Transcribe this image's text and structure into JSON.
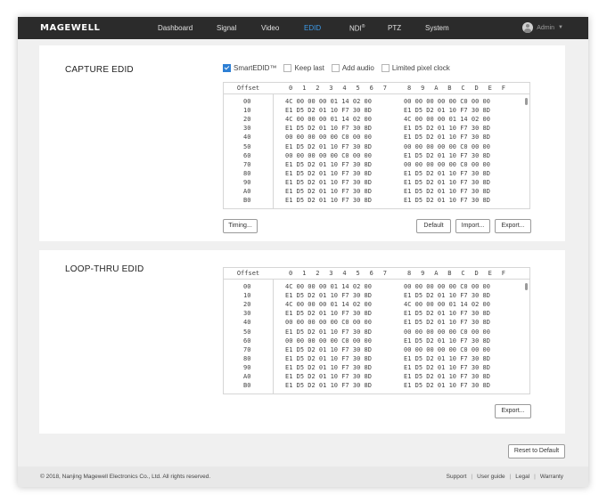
{
  "brand": "MAGEWELL",
  "nav": [
    "Dashboard",
    "Signal",
    "Video",
    "EDID",
    "NDI",
    "PTZ",
    "System"
  ],
  "nav_active": "EDID",
  "ndi_mark": "®",
  "user": "Admin",
  "capture": {
    "title": "CAPTURE EDID",
    "options": [
      {
        "label": "SmartEDID™",
        "checked": true
      },
      {
        "label": "Keep last",
        "checked": false
      },
      {
        "label": "Add audio",
        "checked": false
      },
      {
        "label": "Limited pixel clock",
        "checked": false
      }
    ],
    "buttons": {
      "timing": "Timing...",
      "default": "Default",
      "import": "Import...",
      "export": "Export..."
    }
  },
  "loop": {
    "title": "LOOP-THRU EDID",
    "buttons": {
      "export": "Export..."
    }
  },
  "hex_header": {
    "offset": "Offset",
    "cols": [
      "0",
      "1",
      "2",
      "3",
      "4",
      "5",
      "6",
      "7",
      "8",
      "9",
      "A",
      "B",
      "C",
      "D",
      "E",
      "F"
    ]
  },
  "capture_rows": [
    {
      "offset": "00",
      "a": "4C 00 00 00 01 14 02 00",
      "b": "00 00 00 00 00 C0 00 00"
    },
    {
      "offset": "10",
      "a": "E1 D5 D2 01 10 F7 30 8D",
      "b": "E1 D5 D2 01 10 F7 30 8D"
    },
    {
      "offset": "20",
      "a": "4C 00 00 00 01 14 02 00",
      "b": "4C 00 00 00 01 14 02 00"
    },
    {
      "offset": "30",
      "a": "E1 D5 D2 01 10 F7 30 8D",
      "b": "E1 D5 D2 01 10 F7 30 8D"
    },
    {
      "offset": "40",
      "a": "00 00 00 00 00 C0 00 00",
      "b": "E1 D5 D2 01 10 F7 30 8D"
    },
    {
      "offset": "50",
      "a": "E1 D5 D2 01 10 F7 30 8D",
      "b": "00 00 00 00 00 C0 00 00"
    },
    {
      "offset": "60",
      "a": "00 00 00 00 00 C0 00 00",
      "b": "E1 D5 D2 01 10 F7 30 8D"
    },
    {
      "offset": "70",
      "a": "E1 D5 D2 01 10 F7 30 8D",
      "b": "00 00 00 00 00 C0 00 00"
    },
    {
      "offset": "80",
      "a": "E1 D5 D2 01 10 F7 30 8D",
      "b": "E1 D5 D2 01 10 F7 30 8D"
    },
    {
      "offset": "90",
      "a": "E1 D5 D2 01 10 F7 30 8D",
      "b": "E1 D5 D2 01 10 F7 30 8D"
    },
    {
      "offset": "A0",
      "a": "E1 D5 D2 01 10 F7 30 8D",
      "b": "E1 D5 D2 01 10 F7 30 8D"
    },
    {
      "offset": "B0",
      "a": "E1 D5 D2 01 10 F7 30 8D",
      "b": "E1 D5 D2 01 10 F7 30 8D"
    }
  ],
  "loop_rows": [
    {
      "offset": "00",
      "a": "4C 00 00 00 01 14 02 00",
      "b": "00 00 00 00 00 C0 00 00"
    },
    {
      "offset": "10",
      "a": "E1 D5 D2 01 10 F7 30 8D",
      "b": "E1 D5 D2 01 10 F7 30 8D"
    },
    {
      "offset": "20",
      "a": "4C 00 00 00 01 14 02 00",
      "b": "4C 00 00 00 01 14 02 00"
    },
    {
      "offset": "30",
      "a": "E1 D5 D2 01 10 F7 30 8D",
      "b": "E1 D5 D2 01 10 F7 30 8D"
    },
    {
      "offset": "40",
      "a": "00 00 00 00 00 C0 00 00",
      "b": "E1 D5 D2 01 10 F7 30 8D"
    },
    {
      "offset": "50",
      "a": "E1 D5 D2 01 10 F7 30 8D",
      "b": "00 00 00 00 00 C0 00 00"
    },
    {
      "offset": "60",
      "a": "00 00 00 00 00 C0 00 00",
      "b": "E1 D5 D2 01 10 F7 30 8D"
    },
    {
      "offset": "70",
      "a": "E1 D5 D2 01 10 F7 30 8D",
      "b": "00 00 00 00 00 C0 00 00"
    },
    {
      "offset": "80",
      "a": "E1 D5 D2 01 10 F7 30 8D",
      "b": "E1 D5 D2 01 10 F7 30 8D"
    },
    {
      "offset": "90",
      "a": "E1 D5 D2 01 10 F7 30 8D",
      "b": "E1 D5 D2 01 10 F7 30 8D"
    },
    {
      "offset": "A0",
      "a": "E1 D5 D2 01 10 F7 30 8D",
      "b": "E1 D5 D2 01 10 F7 30 8D"
    },
    {
      "offset": "B0",
      "a": "E1 D5 D2 01 10 F7 30 8D",
      "b": "E1 D5 D2 01 10 F7 30 8D"
    }
  ],
  "reset_label": "Reset to Default",
  "footer": {
    "copyright": "© 2018, Nanjing Magewell Electronics Co., Ltd. All rights reserved.",
    "links": [
      "Support",
      "User guide",
      "Legal",
      "Warranty"
    ],
    "separator": "|"
  },
  "colors": {
    "accent": "#3d9be9",
    "topbar": "#2b2b2b",
    "checkbox": "#2d7fd4"
  }
}
